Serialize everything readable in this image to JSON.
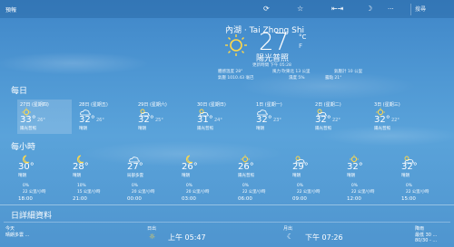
{
  "app": {
    "title": "預報"
  },
  "toolbar": {
    "refresh_icon": "refresh-icon",
    "favorite_icon": "star-icon",
    "pin_icon": "pin-icon",
    "theme_icon": "moon-icon",
    "more_label": "···",
    "search_placeholder": "搜尋"
  },
  "current": {
    "location": "內湖 · Tai Zhong Shi",
    "temperature": "27",
    "unit_c": "°C",
    "unit_f": "F",
    "condition": "陽光普照",
    "updated": "更新時間 下午 05:28",
    "details_row1": [
      "體感溫度 28°",
      "風力 吹東北 13 公里",
      "氣壓計 10 公里"
    ],
    "details_row2": [
      "氣壓 1010.43 毫巴",
      "濕度 5%",
      "露點 21°"
    ]
  },
  "daily": {
    "title": "每日",
    "days": [
      {
        "name": "27日 (星期四)",
        "icon": "sun-icon",
        "hi": "33°",
        "lo": "26°",
        "cond": "陽光普照",
        "selected": true
      },
      {
        "name": "28日 (星期五)",
        "icon": "cloud-icon",
        "hi": "32°",
        "lo": "26°",
        "cond": "晴朗",
        "selected": false
      },
      {
        "name": "29日 (星期六)",
        "icon": "partly-sunny-icon",
        "hi": "32°",
        "lo": "25°",
        "cond": "晴朗",
        "selected": false
      },
      {
        "name": "30日 (星期日)",
        "icon": "partly-sunny-icon",
        "hi": "31°",
        "lo": "24°",
        "cond": "陽光普照",
        "selected": false
      },
      {
        "name": "1日 (星期一)",
        "icon": "cloud-icon",
        "hi": "32°",
        "lo": "23°",
        "cond": "晴朗",
        "selected": false
      },
      {
        "name": "2日 (星期二)",
        "icon": "partly-sunny-icon",
        "hi": "32°",
        "lo": "22°",
        "cond": "陽光普照",
        "selected": false
      },
      {
        "name": "3日 (星期三)",
        "icon": "sun-icon",
        "hi": "32°",
        "lo": "22°",
        "cond": "陽光普照",
        "selected": false
      }
    ]
  },
  "hourly": {
    "title": "每小時",
    "hours": [
      {
        "icon": "moon-icon",
        "temp": "30°",
        "cond": "晴朗",
        "rain": "0%",
        "wind": "22 公里/小時",
        "time": "18:00"
      },
      {
        "icon": "moon-icon",
        "temp": "28°",
        "cond": "晴朗",
        "rain": "10%",
        "wind": "15 公里/小時",
        "time": "21:00"
      },
      {
        "icon": "cloud-icon",
        "temp": "27°",
        "cond": "局部多雲",
        "rain": "0%",
        "wind": "20 公里/小時",
        "time": "00:00"
      },
      {
        "icon": "moon-icon",
        "temp": "26°",
        "cond": "晴朗",
        "rain": "0%",
        "wind": "20 公里/小時",
        "time": "03:00"
      },
      {
        "icon": "sun-icon",
        "temp": "26°",
        "cond": "陽光普照",
        "rain": "0%",
        "wind": "22 公里/小時",
        "time": "06:00"
      },
      {
        "icon": "partly-sunny-icon",
        "temp": "29°",
        "cond": "晴朗",
        "rain": "0%",
        "wind": "22 公里/小時",
        "time": "09:00"
      },
      {
        "icon": "sun-icon",
        "temp": "32°",
        "cond": "晴朗",
        "rain": "0%",
        "wind": "22 公里/小時",
        "time": "12:00"
      },
      {
        "icon": "partly-sunny-icon",
        "temp": "32°",
        "cond": "晴朗",
        "rain": "0%",
        "wind": "22 公里/小時",
        "time": "15:00"
      }
    ]
  },
  "daily_details": {
    "title": "日詳細資料",
    "today_label": "今天",
    "today_text": "晴朗多雲 ...",
    "sunrise_label": "日出",
    "sunrise_time": "上午 05:47",
    "moonrise_label": "月出",
    "moonrise_time": "下午 07:26",
    "rain_label": "降雨",
    "rain_text": "最低 30 ...",
    "rain_sub": "80/30 - ..."
  }
}
